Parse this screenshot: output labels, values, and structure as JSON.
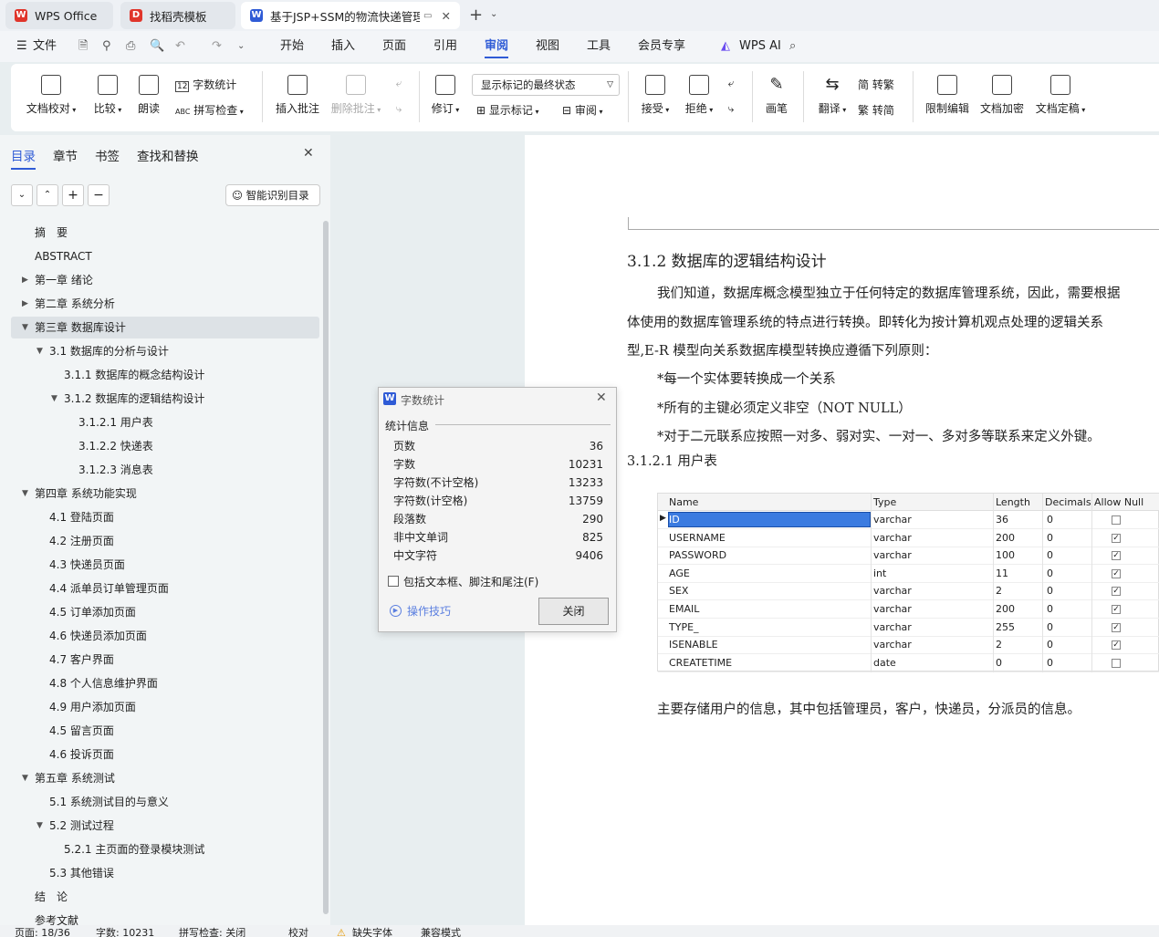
{
  "tabs": [
    {
      "label": "WPS Office"
    },
    {
      "label": "找稻壳模板"
    },
    {
      "label": "基于JSP+SSM的物流快递管理"
    }
  ],
  "menu": {
    "file": "文件",
    "items": [
      "开始",
      "插入",
      "页面",
      "引用",
      "审阅",
      "视图",
      "工具",
      "会员专享"
    ],
    "ai": "WPS AI"
  },
  "ribbon": {
    "proofread": "文档校对",
    "compare": "比较",
    "read": "朗读",
    "word_count": "字数统计",
    "spell_check": "拼写检查",
    "insert_comment": "插入批注",
    "delete_comment": "删除批注",
    "revise": "修订",
    "markup_state": "显示标记的最终状态",
    "show_markup": "显示标记",
    "review": "审阅",
    "accept": "接受",
    "reject": "拒绝",
    "pen": "画笔",
    "translate": "翻译",
    "to_traditional": "简 转繁",
    "to_simple": "繁 转简",
    "restrict": "限制编辑",
    "encrypt": "文档加密",
    "finalize": "文档定稿"
  },
  "panel": {
    "tabs": [
      "目录",
      "章节",
      "书签",
      "查找和替换"
    ],
    "smart_toc": "智能识别目录",
    "toc": [
      {
        "label": "摘　要",
        "level": 0
      },
      {
        "label": "ABSTRACT",
        "level": 0
      },
      {
        "label": "第一章  绪论",
        "level": 0,
        "arrow": "right"
      },
      {
        "label": "第二章  系统分析",
        "level": 0,
        "arrow": "right"
      },
      {
        "label": "第三章  数据库设计",
        "level": 0,
        "arrow": "down",
        "active": true
      },
      {
        "label": "3.1 数据库的分析与设计",
        "level": 1,
        "arrow": "down"
      },
      {
        "label": "3.1.1 数据库的概念结构设计",
        "level": 2
      },
      {
        "label": "3.1.2 数据库的逻辑结构设计",
        "level": 2,
        "arrow": "down"
      },
      {
        "label": "3.1.2.1  用户表",
        "level": 3
      },
      {
        "label": "3.1.2.2 快递表",
        "level": 3
      },
      {
        "label": "3.1.2.3 消息表",
        "level": 3
      },
      {
        "label": "第四章  系统功能实现",
        "level": 0,
        "arrow": "down"
      },
      {
        "label": "4.1 登陆页面",
        "level": 1
      },
      {
        "label": "4.2 注册页面",
        "level": 1
      },
      {
        "label": "4.3 快递员页面",
        "level": 1
      },
      {
        "label": "4.4 派单员订单管理页面",
        "level": 1
      },
      {
        "label": "4.5 订单添加页面",
        "level": 1
      },
      {
        "label": "4.6 快递员添加页面",
        "level": 1
      },
      {
        "label": "4.7 客户界面",
        "level": 1
      },
      {
        "label": "4.8  个人信息维护界面",
        "level": 1
      },
      {
        "label": "4.9 用户添加页面",
        "level": 1
      },
      {
        "label": "4.5 留言页面",
        "level": 1
      },
      {
        "label": "4.6 投诉页面",
        "level": 1
      },
      {
        "label": "第五章  系统测试",
        "level": 0,
        "arrow": "down"
      },
      {
        "label": "5.1 系统测试目的与意义",
        "level": 1
      },
      {
        "label": "5.2 测试过程",
        "level": 1,
        "arrow": "down"
      },
      {
        "label": "5.2.1 主页面的登录模块测试",
        "level": 2
      },
      {
        "label": "5.3 其他错误",
        "level": 1
      },
      {
        "label": "结　论",
        "level": 0
      },
      {
        "label": "参考文献",
        "level": 0
      }
    ]
  },
  "doc": {
    "heading": "3.1.2 数据库的逻辑结构设计",
    "para1": "我们知道，数据库概念模型独立于任何特定的数据库管理系统，因此，需要根据",
    "para2": "体使用的数据库管理系统的特点进行转换。即转化为按计算机观点处理的逻辑关系",
    "para3": "型,E-R 模型向关系数据库模型转换应遵循下列原则：",
    "rule1": "*每一个实体要转换成一个关系",
    "rule2": "*所有的主键必须定义非空（NOT NULL）",
    "rule3": "*对于二元联系应按照一对多、弱对实、一对一、多对多等联系来定义外键。",
    "sub_heading": "3.1.2.1 用户表",
    "caption": "主要存储用户的信息，其中包括管理员，客户，快递员，分派员的信息。"
  },
  "table": {
    "headers": [
      "Name",
      "Type",
      "Length",
      "Decimals",
      "Allow Null"
    ],
    "rows": [
      {
        "name": "ID",
        "type": "varchar",
        "length": "36",
        "decimals": "0",
        "null": false
      },
      {
        "name": "USERNAME",
        "type": "varchar",
        "length": "200",
        "decimals": "0",
        "null": true
      },
      {
        "name": "PASSWORD",
        "type": "varchar",
        "length": "100",
        "decimals": "0",
        "null": true
      },
      {
        "name": "AGE",
        "type": "int",
        "length": "11",
        "decimals": "0",
        "null": true
      },
      {
        "name": "SEX",
        "type": "varchar",
        "length": "2",
        "decimals": "0",
        "null": true
      },
      {
        "name": "EMAIL",
        "type": "varchar",
        "length": "200",
        "decimals": "0",
        "null": true
      },
      {
        "name": "TYPE_",
        "type": "varchar",
        "length": "255",
        "decimals": "0",
        "null": true
      },
      {
        "name": "ISENABLE",
        "type": "varchar",
        "length": "2",
        "decimals": "0",
        "null": true
      },
      {
        "name": "CREATETIME",
        "type": "date",
        "length": "0",
        "decimals": "0",
        "null": false
      }
    ]
  },
  "dialog": {
    "title": "字数统计",
    "section": "统计信息",
    "stats": [
      {
        "label": "页数",
        "value": "36"
      },
      {
        "label": "字数",
        "value": "10231"
      },
      {
        "label": "字符数(不计空格)",
        "value": "13233"
      },
      {
        "label": "字符数(计空格)",
        "value": "13759"
      },
      {
        "label": "段落数",
        "value": "290"
      },
      {
        "label": "非中文单词",
        "value": "825"
      },
      {
        "label": "中文字符",
        "value": "9406"
      }
    ],
    "checkbox": "包括文本框、脚注和尾注(F)",
    "tips": "操作技巧",
    "close": "关闭"
  },
  "status": {
    "page": "页面: 18/36",
    "words": "字数: 10231",
    "spell": "拼写检查: 关闭",
    "proof": "校对",
    "missing_font": "缺失字体",
    "compat": "兼容模式"
  },
  "colors": {
    "accent": "#2f5bd6",
    "wps_red": "#e0352b"
  }
}
